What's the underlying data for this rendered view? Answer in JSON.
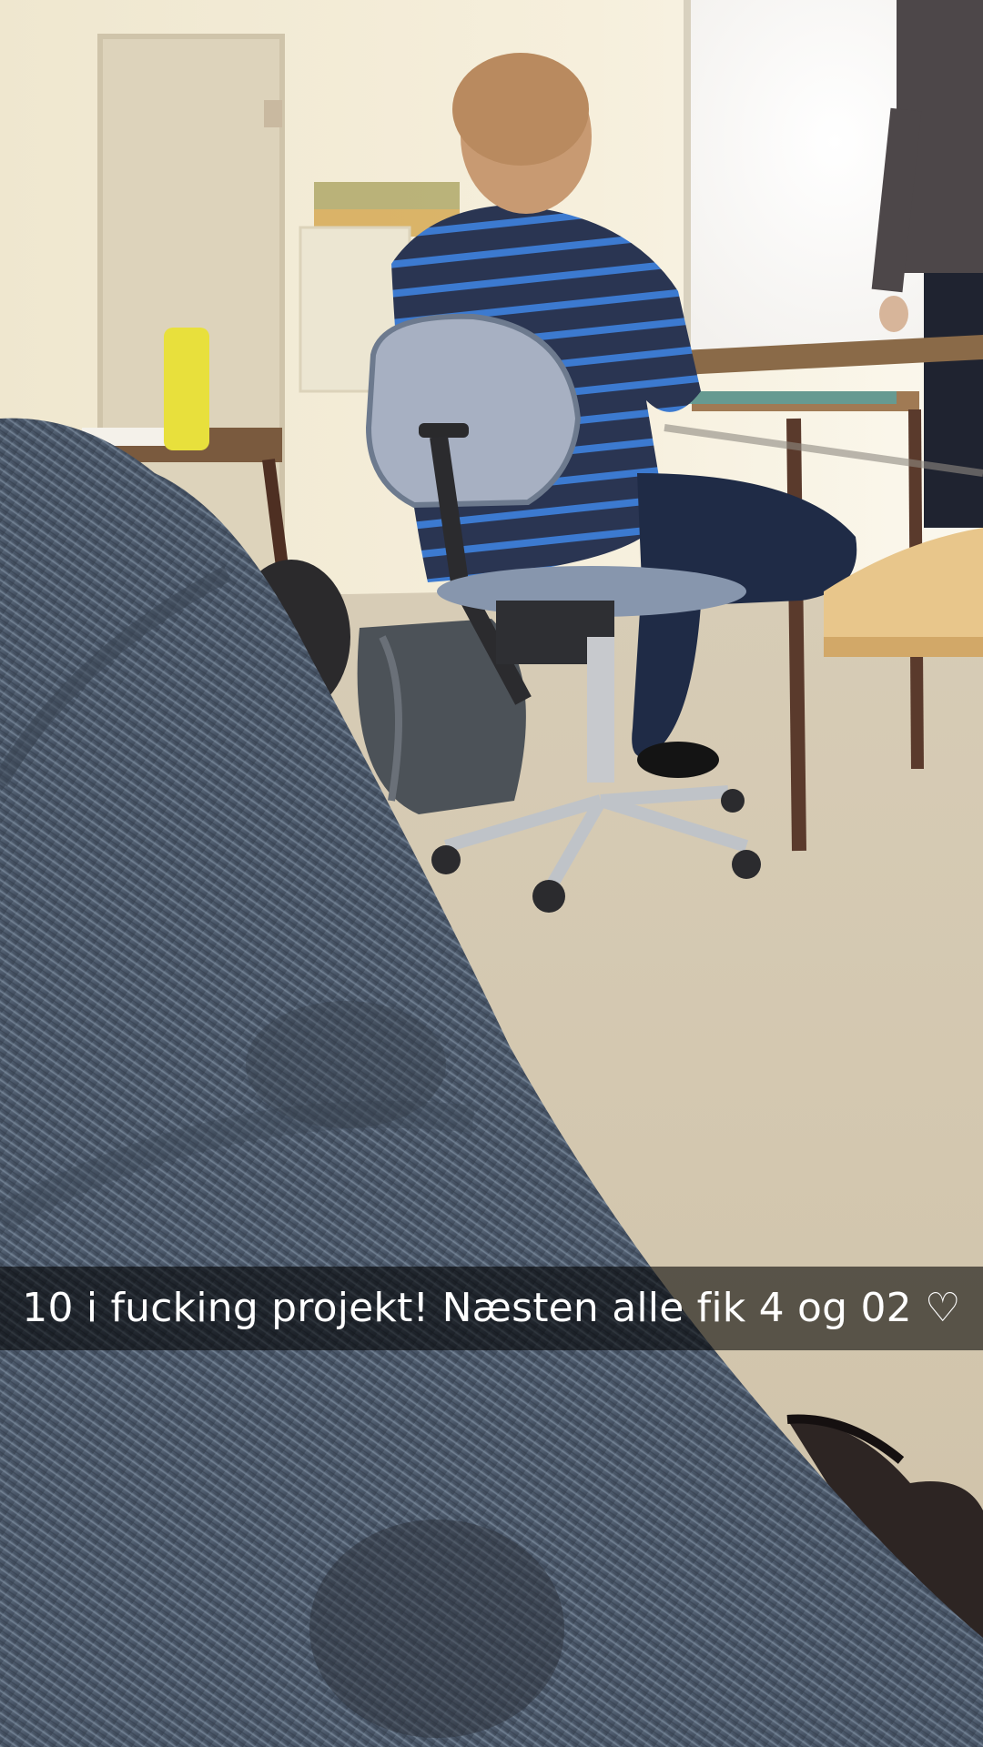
{
  "snap": {
    "caption": "10 i fucking projekt! Næsten alle fik 4 og 02 ♡"
  },
  "colors": {
    "caption_background": "#00000094",
    "caption_text": "#ffffff",
    "wall": "#f4ecd6",
    "floor": "#d9cdb6",
    "denim": "#4c5a6d",
    "sweater_stripe": "#3c7ad0"
  }
}
